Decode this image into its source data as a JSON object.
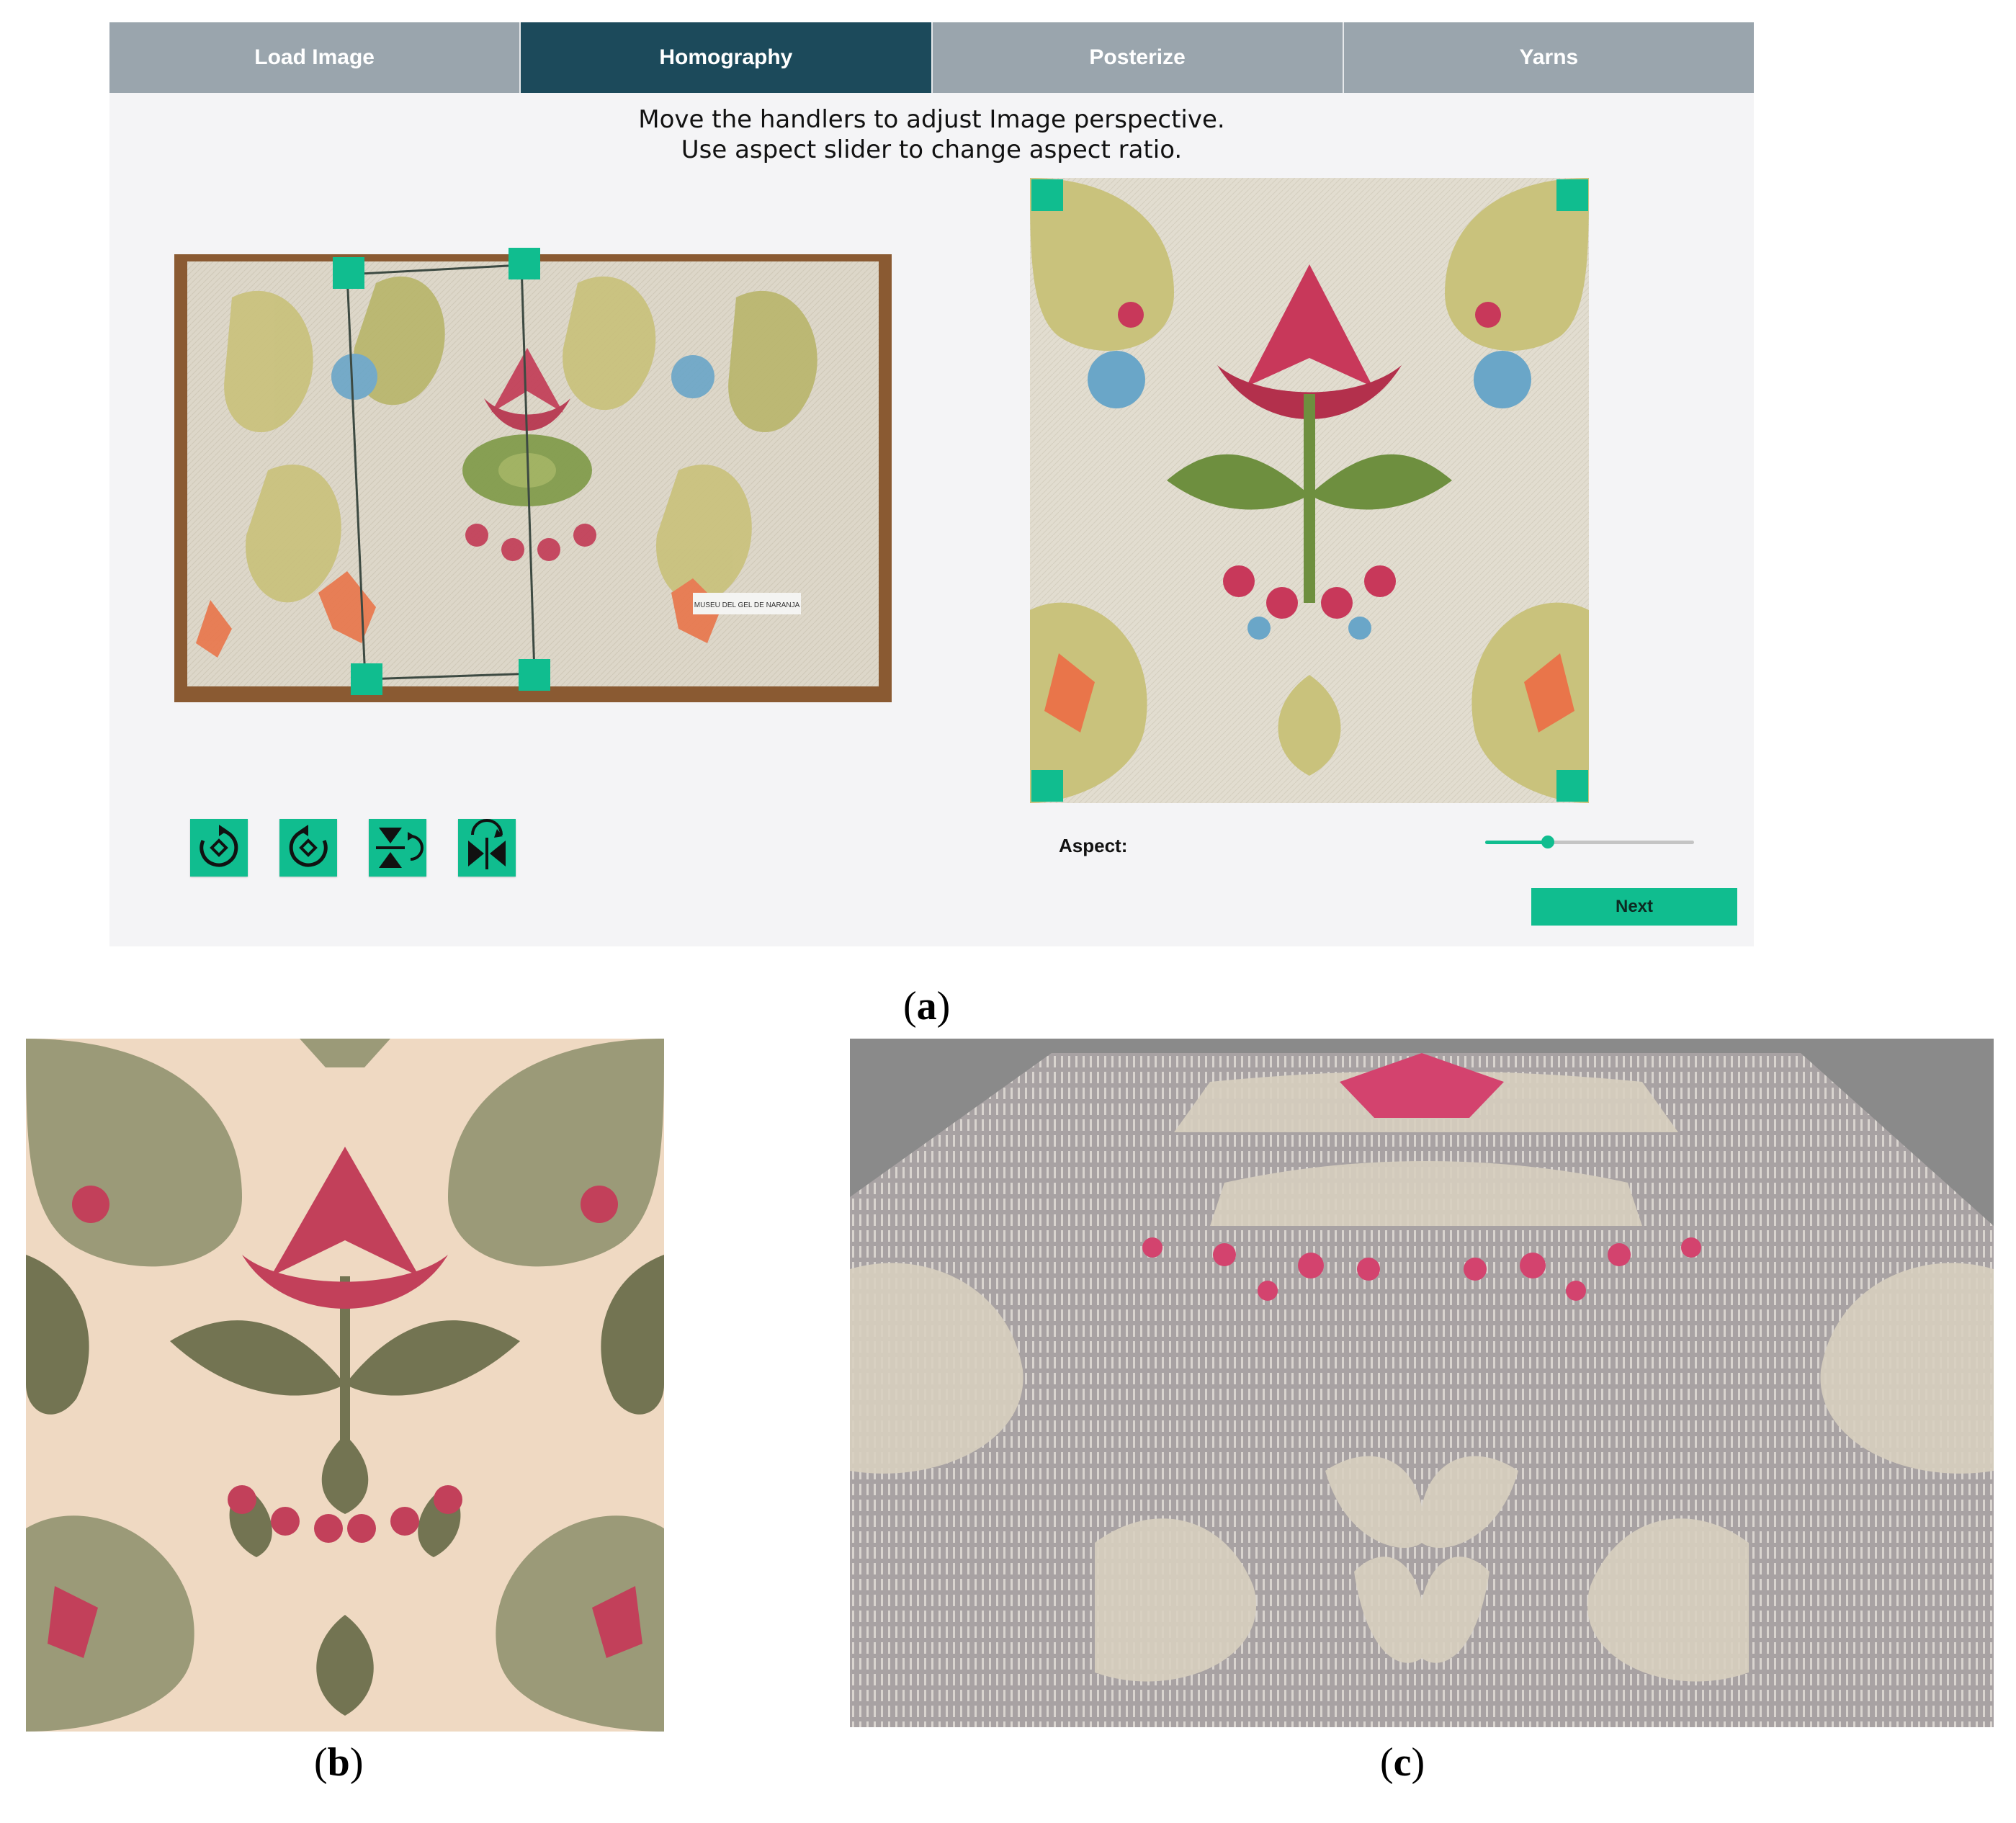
{
  "tabs": [
    {
      "label": "Load Image",
      "active": false
    },
    {
      "label": "Homography",
      "active": true
    },
    {
      "label": "Posterize",
      "active": false
    },
    {
      "label": "Yarns",
      "active": false
    }
  ],
  "instructions": {
    "line1": "Move the handlers to adjust Image perspective.",
    "line2": "Use aspect slider to change aspect ratio."
  },
  "tools": [
    {
      "icon": "rotate-clockwise-icon"
    },
    {
      "icon": "rotate-counterclockwise-icon"
    },
    {
      "icon": "flip-vertical-icon"
    },
    {
      "icon": "flip-horizontal-icon"
    }
  ],
  "aspect": {
    "label": "Aspect:",
    "value": 0.3
  },
  "next_label": "Next",
  "photo_tag_text": "MUSEU DEL GEL DE NARANJA",
  "captions": {
    "a": {
      "open": "(",
      "letter": "a",
      "close": ")"
    },
    "b": {
      "open": "(",
      "letter": "b",
      "close": ")"
    },
    "c": {
      "open": "(",
      "letter": "c",
      "close": ")"
    }
  },
  "colors": {
    "accent": "#10bd8f",
    "tab_active": "#1c4a5b",
    "tab_inactive": "#9aa5ad",
    "background": "#f4f4f6"
  }
}
